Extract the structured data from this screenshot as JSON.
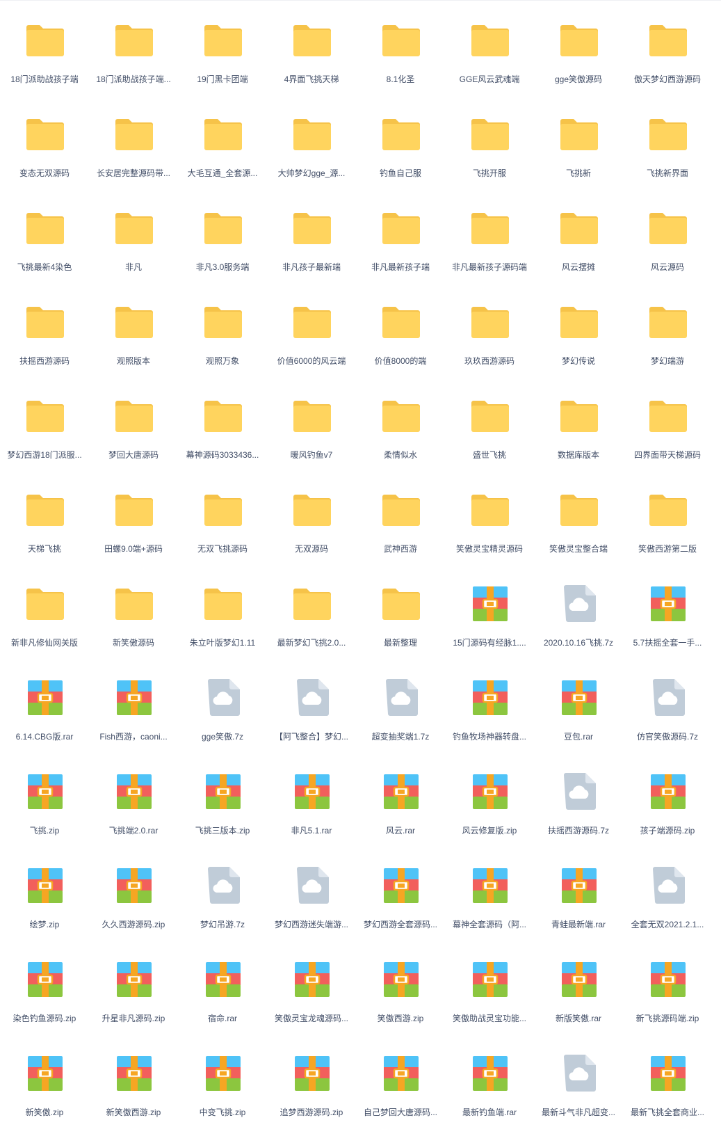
{
  "colors": {
    "folder_body": "#ffd45e",
    "folder_tab": "#f6c349",
    "archive_blue": "#4fc3f7",
    "archive_red": "#f25f5c",
    "archive_green": "#8cc63f",
    "archive_band": "#f6a623",
    "cloud_doc": "#c0ccd8",
    "label_text": "#424e67"
  },
  "files": [
    {
      "name": "18门派助战孩子端",
      "type": "folder"
    },
    {
      "name": "18门派助战孩子端...",
      "type": "folder"
    },
    {
      "name": "19门黑卡团端",
      "type": "folder"
    },
    {
      "name": "4界面飞挑天梯",
      "type": "folder"
    },
    {
      "name": "8.1化圣",
      "type": "folder"
    },
    {
      "name": "GGE风云武魂端",
      "type": "folder"
    },
    {
      "name": "gge笑傲源码",
      "type": "folder"
    },
    {
      "name": "傲天梦幻西游源码",
      "type": "folder"
    },
    {
      "name": "变态无双源码",
      "type": "folder"
    },
    {
      "name": "长安居完整源码带...",
      "type": "folder"
    },
    {
      "name": "大毛互通_全套源...",
      "type": "folder"
    },
    {
      "name": "大帅梦幻gge_源...",
      "type": "folder"
    },
    {
      "name": "钓鱼自己服",
      "type": "folder"
    },
    {
      "name": "飞挑开服",
      "type": "folder"
    },
    {
      "name": "飞挑新",
      "type": "folder"
    },
    {
      "name": "飞挑新界面",
      "type": "folder"
    },
    {
      "name": "飞挑最新4染色",
      "type": "folder"
    },
    {
      "name": "非凡",
      "type": "folder"
    },
    {
      "name": "非凡3.0服务端",
      "type": "folder"
    },
    {
      "name": "非凡孩子最新端",
      "type": "folder"
    },
    {
      "name": "非凡最新孩子端",
      "type": "folder"
    },
    {
      "name": "非凡最新孩子源码端",
      "type": "folder"
    },
    {
      "name": "风云摆摊",
      "type": "folder"
    },
    {
      "name": "风云源码",
      "type": "folder"
    },
    {
      "name": "扶摇西游源码",
      "type": "folder"
    },
    {
      "name": "观照版本",
      "type": "folder"
    },
    {
      "name": "观照万象",
      "type": "folder"
    },
    {
      "name": "价值6000的风云端",
      "type": "folder"
    },
    {
      "name": "价值8000的端",
      "type": "folder"
    },
    {
      "name": "玖玖西游源码",
      "type": "folder"
    },
    {
      "name": "梦幻传说",
      "type": "folder"
    },
    {
      "name": "梦幻端游",
      "type": "folder"
    },
    {
      "name": "梦幻西游18门派服...",
      "type": "folder"
    },
    {
      "name": "梦回大唐源码",
      "type": "folder"
    },
    {
      "name": "幕神源码3033436...",
      "type": "folder"
    },
    {
      "name": "暖风钓鱼v7",
      "type": "folder"
    },
    {
      "name": "柔情似水",
      "type": "folder"
    },
    {
      "name": "盛世飞挑",
      "type": "folder"
    },
    {
      "name": "数据库版本",
      "type": "folder"
    },
    {
      "name": "四界面带天梯源码",
      "type": "folder"
    },
    {
      "name": "天梯飞挑",
      "type": "folder"
    },
    {
      "name": "田螺9.0端+源码",
      "type": "folder"
    },
    {
      "name": "无双飞挑源码",
      "type": "folder"
    },
    {
      "name": "无双源码",
      "type": "folder"
    },
    {
      "name": "武神西游",
      "type": "folder"
    },
    {
      "name": "笑傲灵宝精灵源码",
      "type": "folder"
    },
    {
      "name": "笑傲灵宝整合端",
      "type": "folder"
    },
    {
      "name": "笑傲西游第二版",
      "type": "folder"
    },
    {
      "name": "新非凡修仙网关版",
      "type": "folder"
    },
    {
      "name": "新笑傲源码",
      "type": "folder"
    },
    {
      "name": "朱立叶版梦幻1.11",
      "type": "folder"
    },
    {
      "name": "最新梦幻飞挑2.0...",
      "type": "folder"
    },
    {
      "name": "最新整理",
      "type": "folder"
    },
    {
      "name": "15门源码有经脉1....",
      "type": "archive"
    },
    {
      "name": "2020.10.16飞挑.7z",
      "type": "cloud"
    },
    {
      "name": "5.7扶摇全套一手...",
      "type": "archive"
    },
    {
      "name": "6.14.CBG版.rar",
      "type": "archive"
    },
    {
      "name": "Fish西游，caoni...",
      "type": "archive"
    },
    {
      "name": "gge笑傲.7z",
      "type": "cloud"
    },
    {
      "name": "【阿飞整合】梦幻...",
      "type": "cloud"
    },
    {
      "name": "超变抽奖端1.7z",
      "type": "cloud"
    },
    {
      "name": "钓鱼牧场神器转盘...",
      "type": "archive"
    },
    {
      "name": "豆包.rar",
      "type": "archive"
    },
    {
      "name": "仿官笑傲源码.7z",
      "type": "cloud"
    },
    {
      "name": "飞挑.zip",
      "type": "archive"
    },
    {
      "name": "飞挑端2.0.rar",
      "type": "archive"
    },
    {
      "name": "飞挑三版本.zip",
      "type": "archive"
    },
    {
      "name": "非凡5.1.rar",
      "type": "archive"
    },
    {
      "name": "风云.rar",
      "type": "archive"
    },
    {
      "name": "风云修复版.zip",
      "type": "archive"
    },
    {
      "name": "扶摇西游源码.7z",
      "type": "cloud"
    },
    {
      "name": "孩子端源码.zip",
      "type": "archive"
    },
    {
      "name": "绘梦.zip",
      "type": "archive"
    },
    {
      "name": "久久西游源码.zip",
      "type": "archive"
    },
    {
      "name": "梦幻吊游.7z",
      "type": "cloud"
    },
    {
      "name": "梦幻西游迷失端游...",
      "type": "cloud"
    },
    {
      "name": "梦幻西游全套源码...",
      "type": "archive"
    },
    {
      "name": "幕神全套源码（阿...",
      "type": "archive"
    },
    {
      "name": "青蛙最新端.rar",
      "type": "archive"
    },
    {
      "name": "全套无双2021.2.1...",
      "type": "cloud"
    },
    {
      "name": "染色钓鱼源码.zip",
      "type": "archive"
    },
    {
      "name": "升星非凡源码.zip",
      "type": "archive"
    },
    {
      "name": "宿命.rar",
      "type": "archive"
    },
    {
      "name": "笑傲灵宝龙魂源码...",
      "type": "archive"
    },
    {
      "name": "笑傲西游.zip",
      "type": "archive"
    },
    {
      "name": "笑傲助战灵宝功能...",
      "type": "archive"
    },
    {
      "name": "新版笑傲.rar",
      "type": "archive"
    },
    {
      "name": "新飞挑源码端.zip",
      "type": "archive"
    },
    {
      "name": "新笑傲.zip",
      "type": "archive"
    },
    {
      "name": "新笑傲西游.zip",
      "type": "archive"
    },
    {
      "name": "中变飞挑.zip",
      "type": "archive"
    },
    {
      "name": "追梦西游源码.zip",
      "type": "archive"
    },
    {
      "name": "自己梦回大唐源码...",
      "type": "archive"
    },
    {
      "name": "最新钓鱼端.rar",
      "type": "archive"
    },
    {
      "name": "最新斗气非凡超变...",
      "type": "cloud"
    },
    {
      "name": "最新飞挑全套商业...",
      "type": "archive"
    }
  ]
}
